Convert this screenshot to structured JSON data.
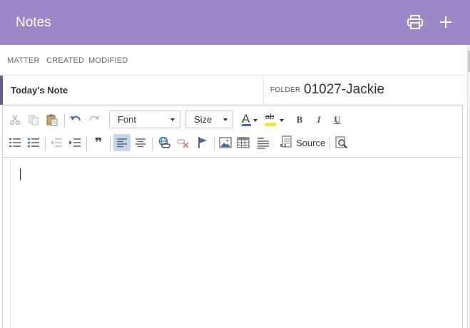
{
  "header": {
    "title": "Notes",
    "print_icon": "printer-icon",
    "add_icon": "plus-icon"
  },
  "meta": {
    "matter_label": "MATTER",
    "created_label": "CREATED",
    "modified_label": "MODIFIED"
  },
  "note": {
    "title": "Today's Note",
    "folder_label": "FOLDER",
    "folder_value": "01027-Jackie"
  },
  "toolbar": {
    "font_label": "Font",
    "size_label": "Size",
    "bold_label": "B",
    "italic_label": "I",
    "underline_label": "U",
    "source_label": "Source",
    "quote_glyph": "❞",
    "font_color_letter": "A",
    "highlight_text": "ab"
  },
  "colors": {
    "header": "#9c87c8",
    "accent": "#6b5a8e",
    "active": "#c5d7ef",
    "icon_blue": "#3b6db2"
  }
}
